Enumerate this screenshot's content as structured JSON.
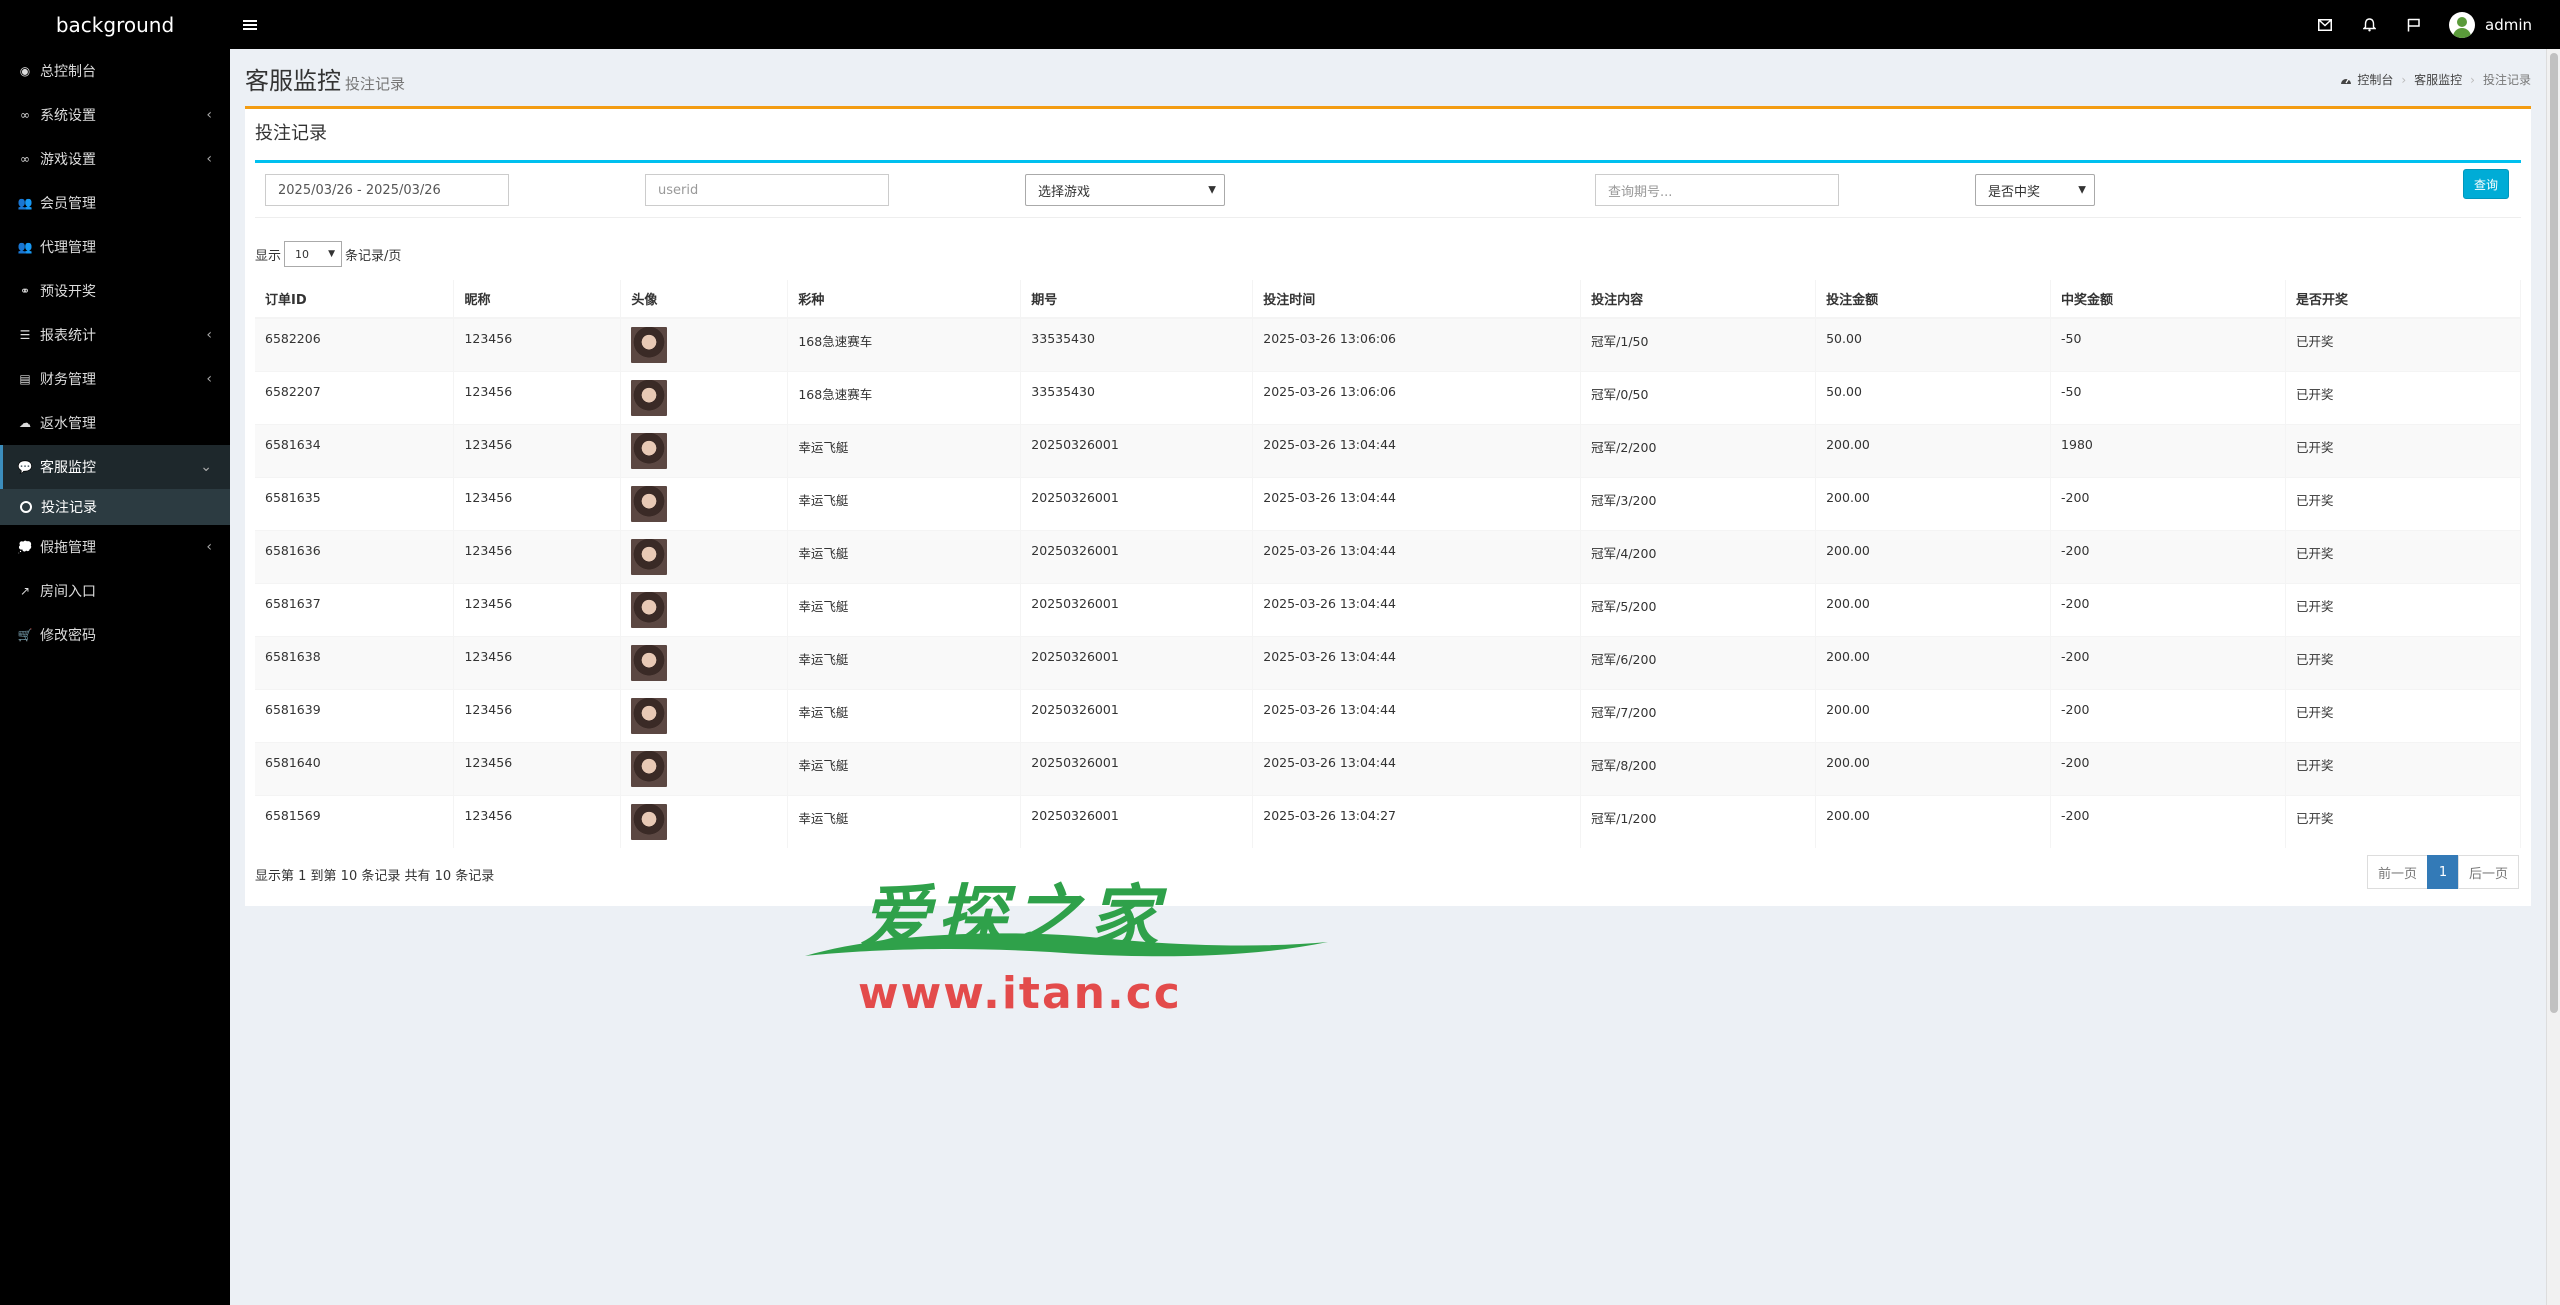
{
  "app": {
    "brand": "background"
  },
  "header": {
    "user": "admin"
  },
  "sidebar": {
    "items": [
      {
        "label": "总控制台",
        "icon": "dashboard-icon",
        "glyph": "◉",
        "caret": false
      },
      {
        "label": "系统设置",
        "icon": "link-icon",
        "glyph": "∞",
        "caret": true
      },
      {
        "label": "游戏设置",
        "icon": "link-icon",
        "glyph": "∞",
        "caret": true
      },
      {
        "label": "会员管理",
        "icon": "users-icon",
        "glyph": "👥",
        "caret": false
      },
      {
        "label": "代理管理",
        "icon": "users-icon",
        "glyph": "👥",
        "caret": false
      },
      {
        "label": "预设开奖",
        "icon": "binoculars-icon",
        "glyph": "⚭",
        "caret": false
      },
      {
        "label": "报表统计",
        "icon": "list-icon",
        "glyph": "☰",
        "caret": true
      },
      {
        "label": "财务管理",
        "icon": "book-icon",
        "glyph": "▤",
        "caret": true
      },
      {
        "label": "返水管理",
        "icon": "cloud-download-icon",
        "glyph": "☁",
        "caret": false
      },
      {
        "label": "客服监控",
        "icon": "comments-icon",
        "glyph": "💬",
        "caret": true,
        "active": true
      },
      {
        "label": "假拖管理",
        "icon": "comment-icon",
        "glyph": "💭",
        "caret": true
      },
      {
        "label": "房间入口",
        "icon": "share-icon",
        "glyph": "↗",
        "caret": false
      },
      {
        "label": "修改密码",
        "icon": "cart-icon",
        "glyph": "🛒",
        "caret": false
      }
    ],
    "submenu": {
      "label": "投注记录"
    }
  },
  "page": {
    "title": "客服监控",
    "subtitle": "投注记录",
    "breadcrumb": {
      "home": "控制台",
      "section": "客服监控",
      "current": "投注记录"
    }
  },
  "box": {
    "title": "投注记录"
  },
  "filters": {
    "date_range": "2025/03/26 - 2025/03/26",
    "userid_placeholder": "userid",
    "game_select": "选择游戏",
    "period_placeholder": "查询期号...",
    "win_select": "是否中奖",
    "query_button": "查询"
  },
  "length": {
    "prefix": "显示",
    "value": "10",
    "suffix": "条记录/页"
  },
  "table": {
    "columns": [
      "订单ID",
      "昵称",
      "头像",
      "彩种",
      "期号",
      "投注时间",
      "投注内容",
      "投注金额",
      "中奖金额",
      "是否开奖"
    ],
    "rows": [
      [
        "6582206",
        "123456",
        "",
        "168急速赛车",
        "33535430",
        "2025-03-26 13:06:06",
        "冠军/1/50",
        "50.00",
        "-50",
        "已开奖"
      ],
      [
        "6582207",
        "123456",
        "",
        "168急速赛车",
        "33535430",
        "2025-03-26 13:06:06",
        "冠军/0/50",
        "50.00",
        "-50",
        "已开奖"
      ],
      [
        "6581634",
        "123456",
        "",
        "幸运飞艇",
        "20250326001",
        "2025-03-26 13:04:44",
        "冠军/2/200",
        "200.00",
        "1980",
        "已开奖"
      ],
      [
        "6581635",
        "123456",
        "",
        "幸运飞艇",
        "20250326001",
        "2025-03-26 13:04:44",
        "冠军/3/200",
        "200.00",
        "-200",
        "已开奖"
      ],
      [
        "6581636",
        "123456",
        "",
        "幸运飞艇",
        "20250326001",
        "2025-03-26 13:04:44",
        "冠军/4/200",
        "200.00",
        "-200",
        "已开奖"
      ],
      [
        "6581637",
        "123456",
        "",
        "幸运飞艇",
        "20250326001",
        "2025-03-26 13:04:44",
        "冠军/5/200",
        "200.00",
        "-200",
        "已开奖"
      ],
      [
        "6581638",
        "123456",
        "",
        "幸运飞艇",
        "20250326001",
        "2025-03-26 13:04:44",
        "冠军/6/200",
        "200.00",
        "-200",
        "已开奖"
      ],
      [
        "6581639",
        "123456",
        "",
        "幸运飞艇",
        "20250326001",
        "2025-03-26 13:04:44",
        "冠军/7/200",
        "200.00",
        "-200",
        "已开奖"
      ],
      [
        "6581640",
        "123456",
        "",
        "幸运飞艇",
        "20250326001",
        "2025-03-26 13:04:44",
        "冠军/8/200",
        "200.00",
        "-200",
        "已开奖"
      ],
      [
        "6581569",
        "123456",
        "",
        "幸运飞艇",
        "20250326001",
        "2025-03-26 13:04:27",
        "冠军/1/200",
        "200.00",
        "-200",
        "已开奖"
      ]
    ]
  },
  "footer": {
    "info": "显示第 1 到第 10 条记录 共有 10 条记录",
    "prev": "前一页",
    "page": "1",
    "next": "后一页"
  },
  "watermark": {
    "cn": "爱探之家",
    "url": "www.itan.cc"
  },
  "colors": {
    "header_bg": "#000000",
    "accent_box": "#f39c12",
    "accent_filter": "#00c0ef",
    "query_btn": "#00acd6",
    "pager_active": "#337ab7",
    "watermark_green": "#2fa14a",
    "watermark_red": "#e34b4b"
  }
}
